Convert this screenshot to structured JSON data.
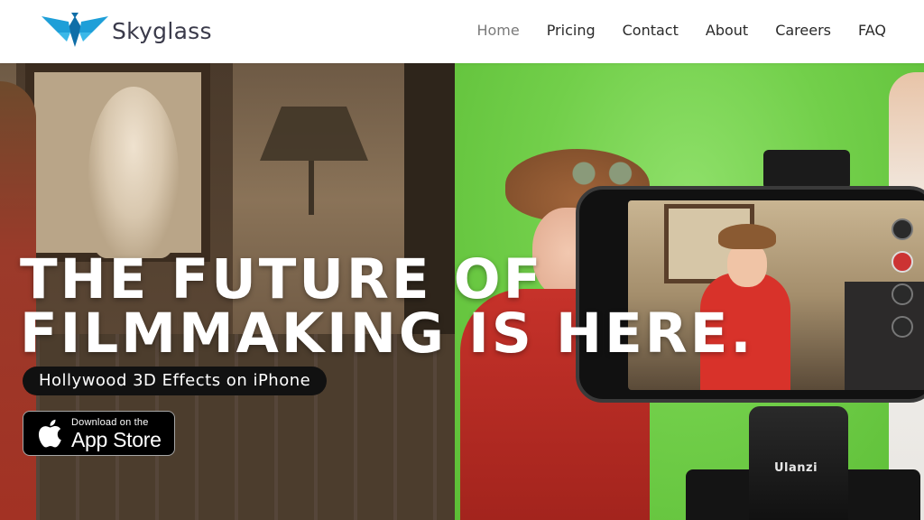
{
  "brand": {
    "name": "Skyglass",
    "logo_icon": "skyglass-logo-icon",
    "logo_color": "#1e9fd8"
  },
  "nav": {
    "items": [
      {
        "label": "Home",
        "active": true
      },
      {
        "label": "Pricing"
      },
      {
        "label": "Contact"
      },
      {
        "label": "About"
      },
      {
        "label": "Careers"
      },
      {
        "label": "FAQ"
      }
    ]
  },
  "hero": {
    "title_line1": "THE FUTURE OF",
    "title_line2": "FILMMAKING IS HERE.",
    "tagline": "Hollywood 3D Effects on iPhone",
    "cta": {
      "small": "Download on the",
      "big": "App Store",
      "icon": "apple-icon"
    },
    "tripod_brand": "Ulanzi"
  },
  "colors": {
    "header_bg": "#ffffff",
    "nav_text": "#2a2a2a",
    "nav_active": "#7a7a7a",
    "greenscreen": "#72cf4a",
    "tagline_bg": "#111111"
  }
}
